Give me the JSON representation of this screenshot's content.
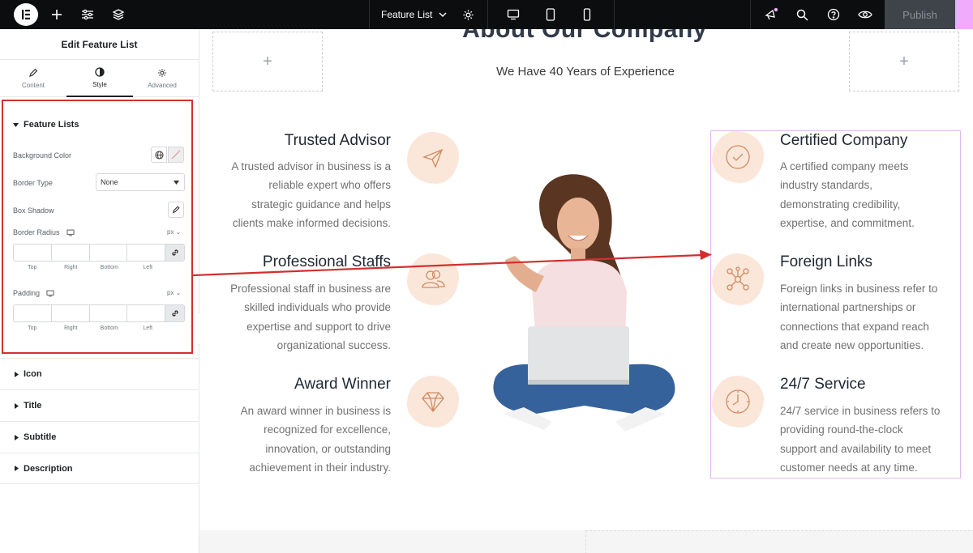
{
  "topbar": {
    "document_title": "Feature List",
    "publish_label": "Publish"
  },
  "panel": {
    "title": "Edit Feature List",
    "tabs": [
      {
        "label": "Content",
        "icon": "pencil-icon"
      },
      {
        "label": "Style",
        "icon": "contrast-icon"
      },
      {
        "label": "Advanced",
        "icon": "gear-icon"
      }
    ],
    "section_title": "Feature Lists",
    "background_color_label": "Background Color",
    "border_type_label": "Border Type",
    "border_type_value": "None",
    "box_shadow_label": "Box Shadow",
    "border_radius_label": "Border Radius",
    "padding_label": "Padding",
    "unit": "px",
    "dim_labels": [
      "Top",
      "Right",
      "Bottom",
      "Left"
    ],
    "accordions": [
      "Icon",
      "Title",
      "Subtitle",
      "Description"
    ]
  },
  "canvas": {
    "heading": "About Our Company",
    "subheading": "We Have 40 Years of Experience",
    "features_left": [
      {
        "title": "Trusted Advisor",
        "text": [
          "A trusted advisor in business is a",
          "reliable expert who offers",
          "strategic guidance and helps",
          "clients make informed decisions."
        ],
        "icon": "paper-plane-icon"
      },
      {
        "title": "Professional Staffs",
        "text": [
          "Professional staff in business are",
          "skilled individuals who provide",
          "expertise and support to drive",
          "organizational success."
        ],
        "icon": "users-icon"
      },
      {
        "title": "Award Winner",
        "text": [
          "An award winner in business is",
          "recognized for excellence,",
          "innovation, or outstanding",
          "achievement in their industry."
        ],
        "icon": "diamond-icon"
      }
    ],
    "features_right": [
      {
        "title": "Certified Company",
        "text": [
          "A certified company meets",
          "industry standards,",
          "demonstrating credibility,",
          "expertise, and commitment."
        ],
        "icon": "check-circle-icon"
      },
      {
        "title": "Foreign Links",
        "text": [
          "Foreign links in business refer to",
          "international partnerships or",
          "connections that expand reach",
          "and create new opportunities."
        ],
        "icon": "network-icon"
      },
      {
        "title": "24/7 Service",
        "text": [
          "24/7 service in business refers to",
          "providing round-the-clock",
          "support and availability to meet",
          "customer needs at any time."
        ],
        "icon": "clock-icon"
      }
    ]
  },
  "colors": {
    "accent_blob": "#fbe7da",
    "icon_stroke": "#d08a60",
    "highlight_red": "#d32f2f",
    "selection_outline": "#e3b7f0"
  }
}
